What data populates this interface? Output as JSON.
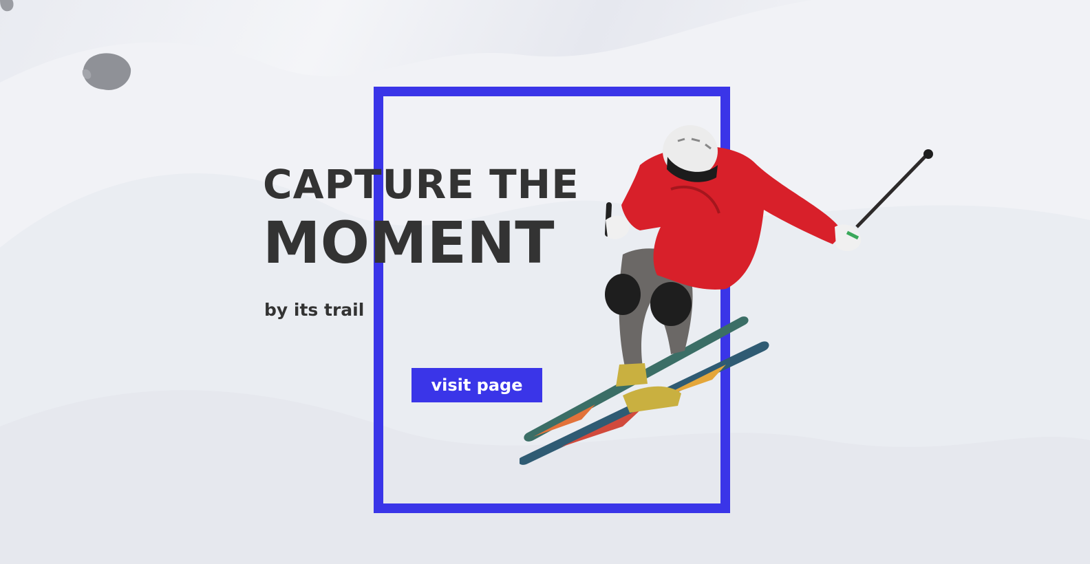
{
  "hero": {
    "headline_line1": "CAPTURE THE",
    "headline_line2": "MOMENT",
    "tagline": "by its trail",
    "cta_label": "visit page"
  },
  "colors": {
    "accent": "#3a35e8",
    "text": "#333333",
    "snow": "#eef0f4",
    "jacket": "#d8202a"
  },
  "images": {
    "background": "snowy-mountain-slope",
    "subject": "skier-mid-jump"
  }
}
